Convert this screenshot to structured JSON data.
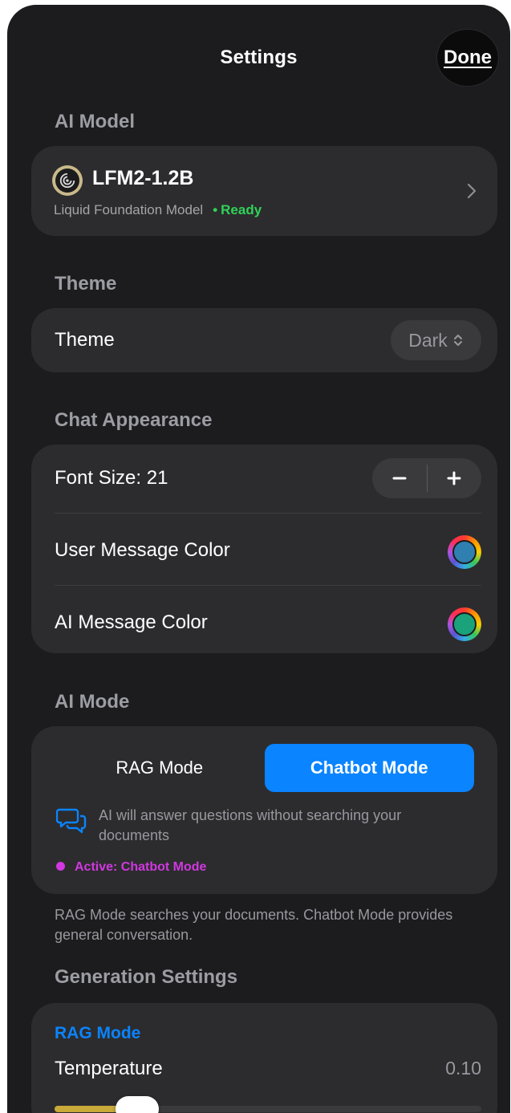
{
  "header": {
    "title": "Settings",
    "done_label": "Done"
  },
  "sections": {
    "ai_model": "AI Model",
    "theme": "Theme",
    "chat_appearance": "Chat Appearance",
    "ai_mode": "AI Mode",
    "generation_settings": "Generation Settings"
  },
  "model": {
    "name": "LFM2-1.2B",
    "subtitle": "Liquid Foundation Model",
    "status_dot": "•",
    "status": "Ready",
    "logo_icon": "spiral-logo-icon",
    "status_color": "#30d158"
  },
  "theme": {
    "label": "Theme",
    "value": "Dark"
  },
  "appearance": {
    "font_size_label": "Font Size: 21",
    "user_color_label": "User Message Color",
    "user_color": "#2f7fb0",
    "ai_color_label": "AI Message Color",
    "ai_color": "#1aa27a"
  },
  "ai_mode": {
    "rag_label": "RAG Mode",
    "chatbot_label": "Chatbot Mode",
    "selected": "Chatbot Mode",
    "accent": "#0a84ff",
    "info_text": "AI will answer questions without searching your documents",
    "active_text": "Active: Chatbot Mode",
    "active_color": "#d138e0",
    "footnote": "RAG Mode searches your documents. Chatbot Mode provides general conversation."
  },
  "generation": {
    "mode_label": "RAG Mode",
    "temperature_label": "Temperature",
    "temperature_value": "0.10",
    "temperature_fraction": 0.1,
    "slider_fill_color": "#c8a93a"
  }
}
